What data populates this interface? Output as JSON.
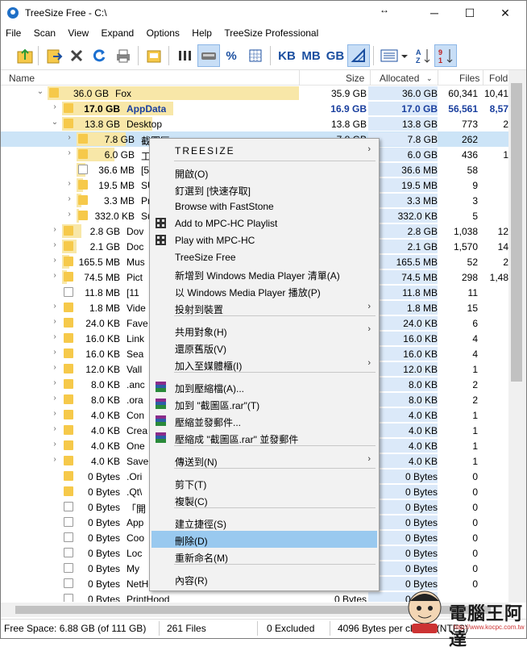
{
  "window": {
    "title": "TreeSize Free - C:\\",
    "resize_glyph": "↔",
    "minimize": "─",
    "maximize": "☐",
    "close": "✕"
  },
  "menu": [
    "File",
    "Scan",
    "View",
    "Expand",
    "Options",
    "Help",
    "TreeSize Professional"
  ],
  "toolbar": {
    "unit_kb": "KB",
    "unit_mb": "MB",
    "unit_gb": "GB",
    "percent": "%"
  },
  "columns": {
    "name": "Name",
    "size": "Size",
    "allocated": "Allocated",
    "files": "Files",
    "folders": "Fold..."
  },
  "rows": [
    {
      "size": "36.0 GB",
      "name": "Fox",
      "c1": "35.9 GB",
      "c2": "36.0 GB",
      "c3": "60,341",
      "c4": "10,41"
    },
    {
      "size": "17.0 GB",
      "name": "AppData",
      "c1": "16.9 GB",
      "c2": "17.0 GB",
      "c3": "56,561",
      "c4": "8,57"
    },
    {
      "size": "13.8 GB",
      "name": "Desktop",
      "c1": "13.8 GB",
      "c2": "13.8 GB",
      "c3": "773",
      "c4": "2"
    },
    {
      "size": "7.8 GB",
      "name": "截圖區",
      "c1": "7.8 GB",
      "c2": "7.8 GB",
      "c3": "262",
      "c4": ""
    },
    {
      "size": "6.0 GB",
      "name": "工",
      "c1": "",
      "c2": "6.0 GB",
      "c3": "436",
      "c4": "1"
    },
    {
      "size": "36.6 MB",
      "name": "[5",
      "c1": "",
      "c2": "36.6 MB",
      "c3": "58",
      "c4": ""
    },
    {
      "size": "19.5 MB",
      "name": "SU",
      "c1": "",
      "c2": "19.5 MB",
      "c3": "9",
      "c4": ""
    },
    {
      "size": "3.3 MB",
      "name": "Pr",
      "c1": "",
      "c2": "3.3 MB",
      "c3": "3",
      "c4": ""
    },
    {
      "size": "332.0 KB",
      "name": "Su",
      "c1": "",
      "c2": "332.0 KB",
      "c3": "5",
      "c4": ""
    },
    {
      "size": "2.8 GB",
      "name": "Dov",
      "c1": "",
      "c2": "2.8 GB",
      "c3": "1,038",
      "c4": "12"
    },
    {
      "size": "2.1 GB",
      "name": "Doc",
      "c1": "",
      "c2": "2.1 GB",
      "c3": "1,570",
      "c4": "14"
    },
    {
      "size": "165.5 MB",
      "name": "Mus",
      "c1": "",
      "c2": "165.5 MB",
      "c3": "52",
      "c4": "2"
    },
    {
      "size": "74.5 MB",
      "name": "Pict",
      "c1": "",
      "c2": "74.5 MB",
      "c3": "298",
      "c4": "1,48"
    },
    {
      "size": "11.8 MB",
      "name": "[11",
      "c1": "",
      "c2": "11.8 MB",
      "c3": "11",
      "c4": ""
    },
    {
      "size": "1.8 MB",
      "name": "Vide",
      "c1": "",
      "c2": "1.8 MB",
      "c3": "15",
      "c4": ""
    },
    {
      "size": "24.0 KB",
      "name": "Fave",
      "c1": "",
      "c2": "24.0 KB",
      "c3": "6",
      "c4": ""
    },
    {
      "size": "16.0 KB",
      "name": "Link",
      "c1": "",
      "c2": "16.0 KB",
      "c3": "4",
      "c4": ""
    },
    {
      "size": "16.0 KB",
      "name": "Sea",
      "c1": "",
      "c2": "16.0 KB",
      "c3": "4",
      "c4": ""
    },
    {
      "size": "12.0 KB",
      "name": "Vall",
      "c1": "",
      "c2": "12.0 KB",
      "c3": "1",
      "c4": ""
    },
    {
      "size": "8.0 KB",
      "name": ".anc",
      "c1": "",
      "c2": "8.0 KB",
      "c3": "2",
      "c4": ""
    },
    {
      "size": "8.0 KB",
      "name": ".ora",
      "c1": "",
      "c2": "8.0 KB",
      "c3": "2",
      "c4": ""
    },
    {
      "size": "4.0 KB",
      "name": "Con",
      "c1": "",
      "c2": "4.0 KB",
      "c3": "1",
      "c4": ""
    },
    {
      "size": "4.0 KB",
      "name": "Crea",
      "c1": "",
      "c2": "4.0 KB",
      "c3": "1",
      "c4": ""
    },
    {
      "size": "4.0 KB",
      "name": "One",
      "c1": "",
      "c2": "4.0 KB",
      "c3": "1",
      "c4": ""
    },
    {
      "size": "4.0 KB",
      "name": "Save",
      "c1": "",
      "c2": "4.0 KB",
      "c3": "1",
      "c4": ""
    },
    {
      "size": "0 Bytes",
      "name": ".Ori",
      "c1": "",
      "c2": "0 Bytes",
      "c3": "0",
      "c4": ""
    },
    {
      "size": "0 Bytes",
      "name": ".Qt\\",
      "c1": "",
      "c2": "0 Bytes",
      "c3": "0",
      "c4": ""
    },
    {
      "size": "0 Bytes",
      "name": "「開",
      "c1": "",
      "c2": "0 Bytes",
      "c3": "0",
      "c4": ""
    },
    {
      "size": "0 Bytes",
      "name": "App",
      "c1": "",
      "c2": "0 Bytes",
      "c3": "0",
      "c4": ""
    },
    {
      "size": "0 Bytes",
      "name": "Coo",
      "c1": "",
      "c2": "0 Bytes",
      "c3": "0",
      "c4": ""
    },
    {
      "size": "0 Bytes",
      "name": "Loc",
      "c1": "",
      "c2": "0 Bytes",
      "c3": "0",
      "c4": ""
    },
    {
      "size": "0 Bytes",
      "name": "My",
      "c1": "",
      "c2": "0 Bytes",
      "c3": "0",
      "c4": ""
    },
    {
      "size": "0 Bytes",
      "name": "NetHood",
      "c1": "0 Bytes",
      "c2": "0 Bytes",
      "c3": "0",
      "c4": ""
    },
    {
      "size": "0 Bytes",
      "name": "PrintHood",
      "c1": "0 Bytes",
      "c2": "0 Bytes",
      "c3": "",
      "c4": ""
    }
  ],
  "context_menu": {
    "header": "TREESIZE",
    "items": [
      {
        "label": "開啟(O)"
      },
      {
        "label": "釘選到 [快速存取]"
      },
      {
        "label": "Browse with FastStone"
      },
      {
        "label": "Add to MPC-HC Playlist"
      },
      {
        "label": "Play with MPC-HC"
      },
      {
        "label": "TreeSize Free"
      },
      {
        "label": "新增到 Windows Media Player 清單(A)"
      },
      {
        "label": "以 Windows Media Player 播放(P)"
      },
      {
        "label": "投射到裝置"
      },
      {
        "label": "共用對象(H)"
      },
      {
        "label": "還原舊版(V)"
      },
      {
        "label": "加入至媒體櫃(I)"
      },
      {
        "label": "加到壓縮檔(A)..."
      },
      {
        "label": "加到 \"截圖區.rar\"(T)"
      },
      {
        "label": "壓縮並發郵件..."
      },
      {
        "label": "壓縮成 \"截圖區.rar\" 並發郵件"
      },
      {
        "label": "傳送到(N)"
      },
      {
        "label": "剪下(T)"
      },
      {
        "label": "複製(C)"
      },
      {
        "label": "建立捷徑(S)"
      },
      {
        "label": "刪除(D)"
      },
      {
        "label": "重新命名(M)"
      },
      {
        "label": "內容(R)"
      }
    ]
  },
  "status": {
    "free_space": "Free Space: 6.88 GB  (of 111 GB)",
    "files": "261  Files",
    "excluded": "0 Excluded",
    "cluster": "4096  Bytes per cluster (NTFS)"
  },
  "watermark": {
    "text": "電腦王阿達",
    "url": "http://www.kocpc.com.tw"
  }
}
